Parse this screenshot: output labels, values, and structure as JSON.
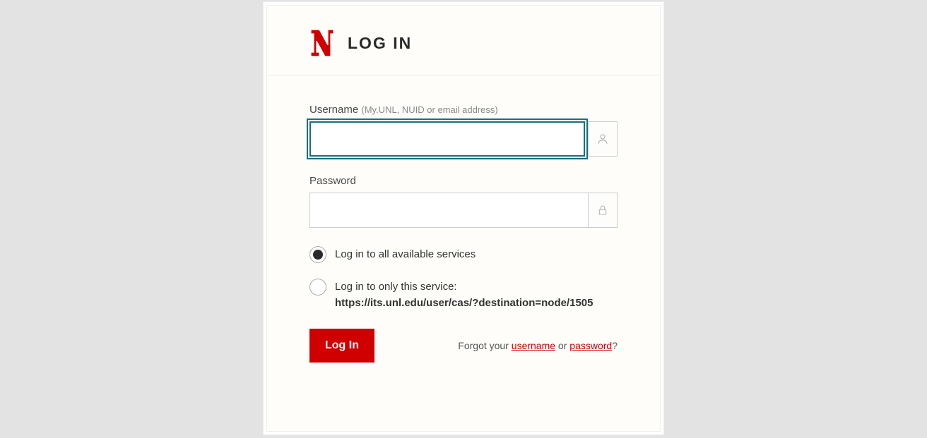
{
  "header": {
    "title": "LOG IN"
  },
  "form": {
    "username": {
      "label": "Username",
      "hint": "(My.UNL, NUID or email address)",
      "value": ""
    },
    "password": {
      "label": "Password",
      "value": ""
    },
    "options": {
      "all_services": "Log in to all available services",
      "only_this": "Log in to only this service:",
      "only_this_url": "https://its.unl.edu/user/cas/?destination=node/1505",
      "selected": "all"
    },
    "submit": "Log In",
    "forgot": {
      "prefix": "Forgot your ",
      "username": "username",
      "middle": " or ",
      "password": "password",
      "suffix": "?"
    }
  }
}
